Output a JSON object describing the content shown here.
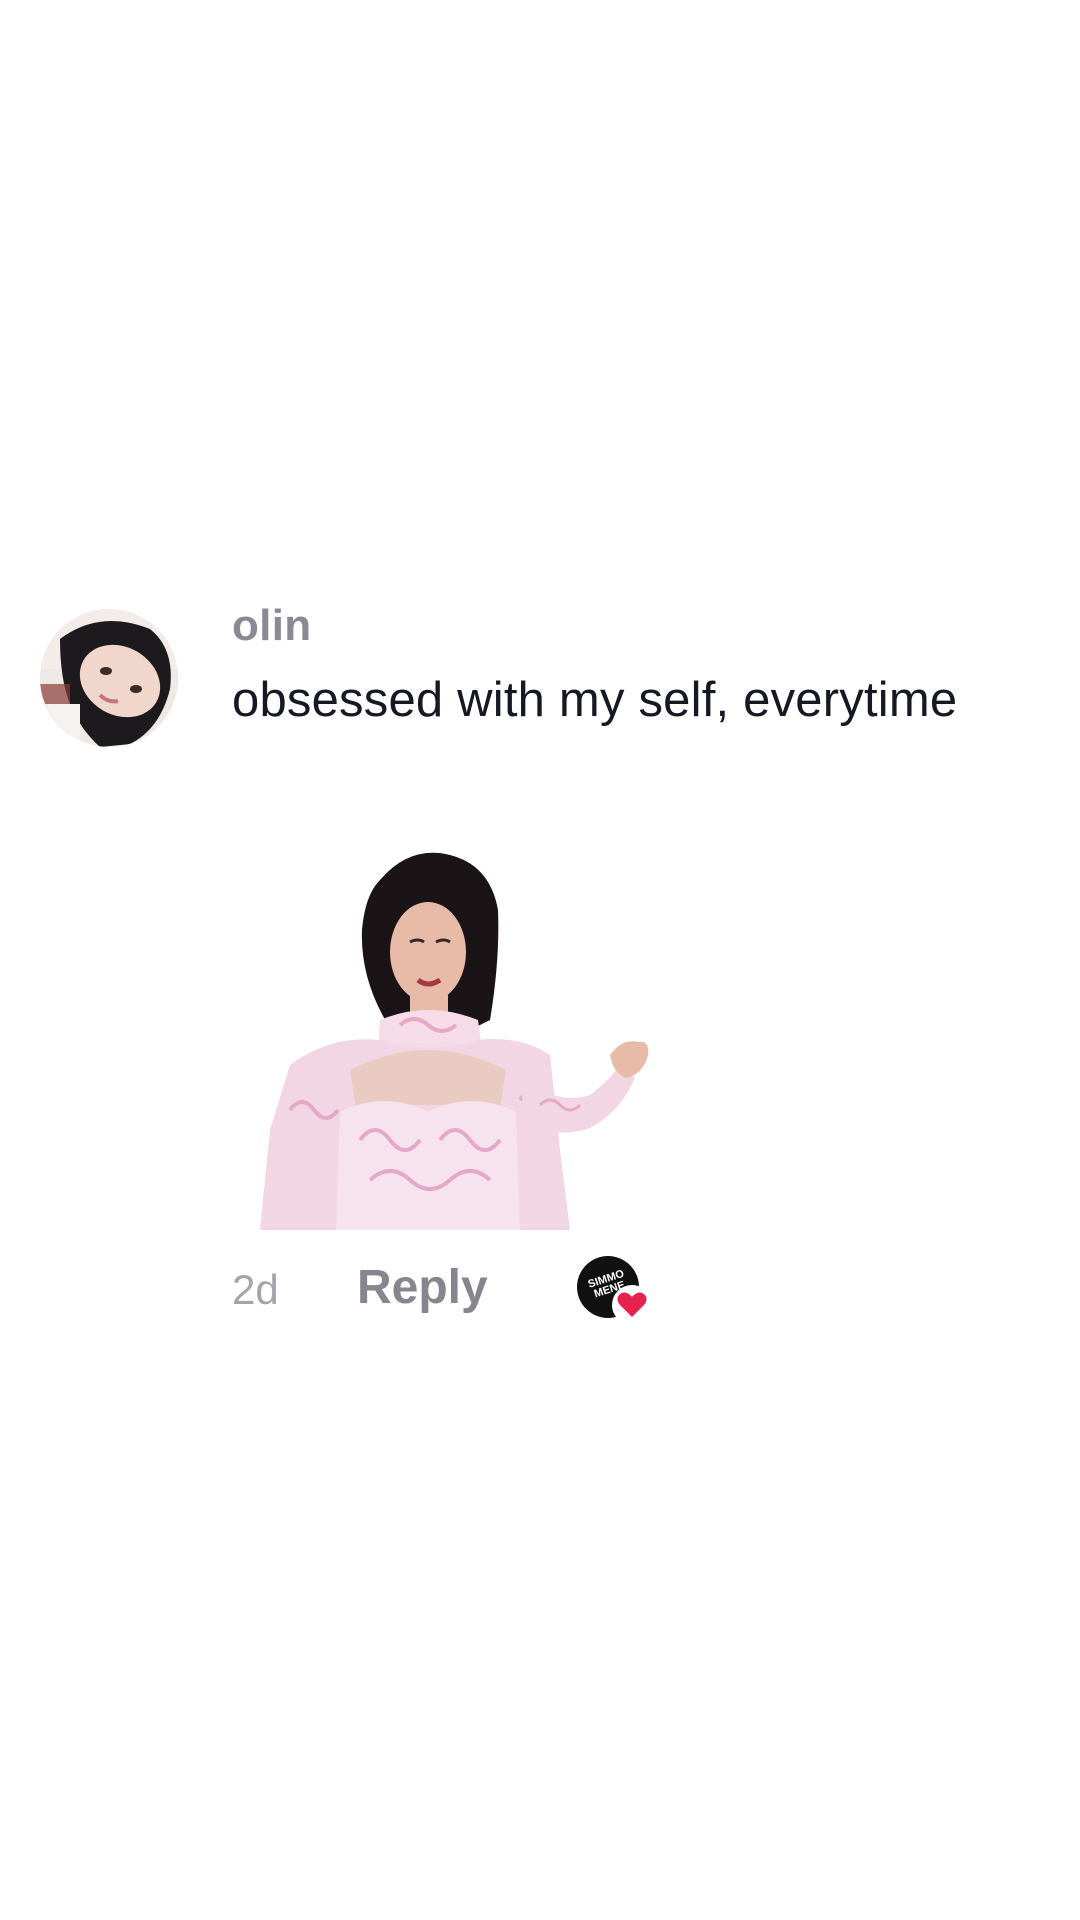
{
  "comment": {
    "username": "olin",
    "text": "obsessed with my self, everytime",
    "sticker_icon": "woman-in-lace-dress-sticker",
    "timestamp": "2d",
    "reply_label": "Reply",
    "creator_like": {
      "avatar_text": "SIMMO MENE",
      "heart_color": "#e8224f",
      "icon": "heart-icon"
    }
  },
  "colors": {
    "background": "#ffffff",
    "username": "#8a8a94",
    "text": "#161823",
    "meta": "#a4a4ac"
  }
}
